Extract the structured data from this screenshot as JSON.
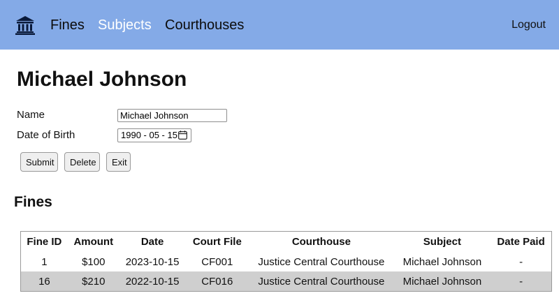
{
  "nav": {
    "links": [
      "Fines",
      "Subjects",
      "Courthouses"
    ],
    "active": "Subjects",
    "logout": "Logout",
    "logo_icon": "courthouse-icon"
  },
  "page": {
    "title": "Michael Johnson"
  },
  "form": {
    "name_label": "Name",
    "name_value": "Michael Johnson",
    "dob_label": "Date of Birth",
    "dob_value": "1990 - 05 - 15",
    "buttons": {
      "submit": "Submit",
      "delete": "Delete",
      "exit": "Exit"
    }
  },
  "fines": {
    "title": "Fines",
    "columns": [
      "Fine ID",
      "Amount",
      "Date",
      "Court File",
      "Courthouse",
      "Subject",
      "Date Paid"
    ],
    "rows": [
      [
        "1",
        "$100",
        "2023-10-15",
        "CF001",
        "Justice Central Courthouse",
        "Michael Johnson",
        "-"
      ],
      [
        "16",
        "$210",
        "2022-10-15",
        "CF016",
        "Justice Central Courthouse",
        "Michael Johnson",
        "-"
      ]
    ]
  },
  "colors": {
    "navbar": "#84aae7",
    "active_link": "#ffffff",
    "alt_row": "#cfcfcf"
  }
}
